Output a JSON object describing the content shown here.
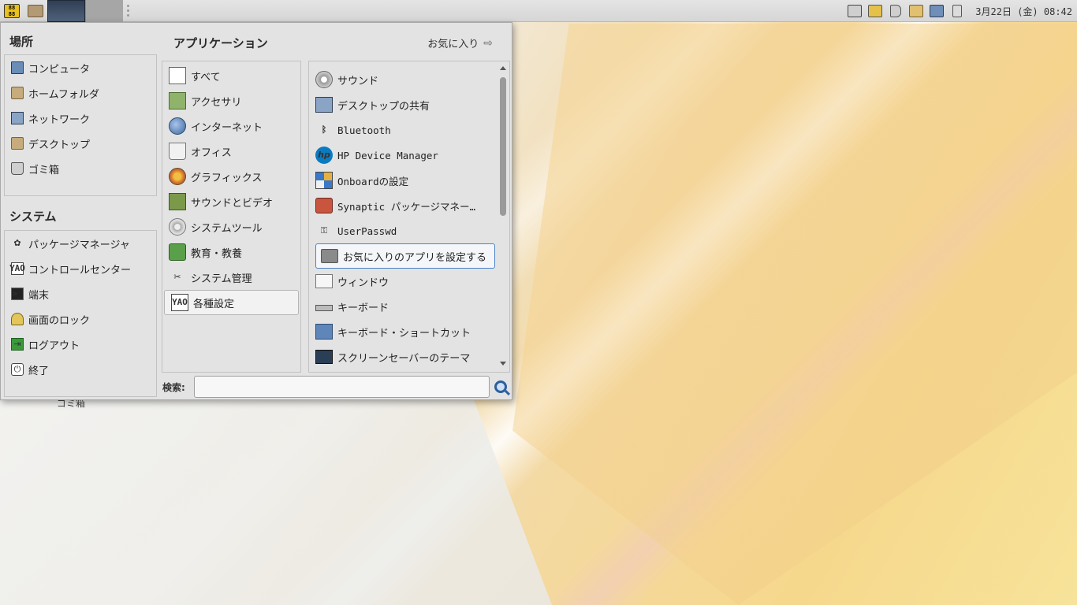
{
  "panel": {
    "clock": "3月22日 (金) 08:42"
  },
  "desktop": {
    "trash_label": "ゴミ箱"
  },
  "menu": {
    "places_title": "場所",
    "places": [
      {
        "label": "コンピュータ",
        "icon": "computer-icon"
      },
      {
        "label": "ホームフォルダ",
        "icon": "home-folder-icon"
      },
      {
        "label": "ネットワーク",
        "icon": "network-icon"
      },
      {
        "label": "デスクトップ",
        "icon": "desktop-folder-icon"
      },
      {
        "label": "ゴミ箱",
        "icon": "trash-icon"
      }
    ],
    "system_title": "システム",
    "system": [
      {
        "label": "パッケージマネージャ",
        "icon": "package-manager-icon"
      },
      {
        "label": "コントロールセンター",
        "icon": "control-center-icon"
      },
      {
        "label": "端末",
        "icon": "terminal-icon"
      },
      {
        "label": "画面のロック",
        "icon": "lock-screen-icon"
      },
      {
        "label": "ログアウト",
        "icon": "logout-icon"
      },
      {
        "label": "終了",
        "icon": "shutdown-icon"
      }
    ],
    "apps_title": "アプリケーション",
    "favorites_label": "お気に入り",
    "categories": [
      {
        "label": "すべて",
        "icon": "all-apps-icon"
      },
      {
        "label": "アクセサリ",
        "icon": "accessories-icon"
      },
      {
        "label": "インターネット",
        "icon": "internet-icon"
      },
      {
        "label": "オフィス",
        "icon": "office-icon"
      },
      {
        "label": "グラフィックス",
        "icon": "graphics-icon"
      },
      {
        "label": "サウンドとビデオ",
        "icon": "sound-video-icon"
      },
      {
        "label": "システムツール",
        "icon": "system-tools-icon"
      },
      {
        "label": "教育・教養",
        "icon": "education-icon"
      },
      {
        "label": "システム管理",
        "icon": "administration-icon"
      },
      {
        "label": "各種設定",
        "icon": "settings-icon"
      }
    ],
    "selected_category": "各種設定",
    "apps": [
      {
        "label": "サウンド",
        "icon": "sound-icon"
      },
      {
        "label": "デスクトップの共有",
        "icon": "desktop-sharing-icon"
      },
      {
        "label": "Bluetooth",
        "icon": "bluetooth-icon"
      },
      {
        "label": "HP Device Manager",
        "icon": "hp-icon"
      },
      {
        "label": "Onboardの設定",
        "icon": "onboard-icon"
      },
      {
        "label": "Synaptic パッケージマネー…",
        "icon": "synaptic-icon"
      },
      {
        "label": "UserPasswd",
        "icon": "key-icon"
      },
      {
        "label": "お気に入りのアプリを設定する",
        "icon": "favorites-config-icon"
      },
      {
        "label": "ウィンドウ",
        "icon": "window-icon"
      },
      {
        "label": "キーボード",
        "icon": "keyboard-icon"
      },
      {
        "label": "キーボード・ショートカット",
        "icon": "keyboard-shortcut-icon"
      },
      {
        "label": "スクリーンセーバーのテーマ",
        "icon": "screensaver-icon"
      }
    ],
    "selected_app": "お気に入りのアプリを設定する",
    "search_label": "検索:",
    "search_value": "",
    "search_placeholder": ""
  }
}
